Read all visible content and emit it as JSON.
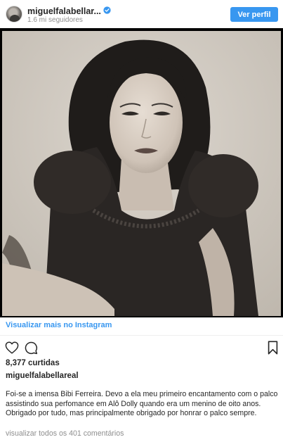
{
  "post": {
    "username": "miguelfalabellar...",
    "followers": "1.6 mi seguidores",
    "view_profile_label": "Ver perfil",
    "view_more_label": "Visualizar mais no Instagram",
    "likes": "8,377 curtidas",
    "caption_user": "miguelfalabellareal",
    "caption_text": "Foi-se a imensa Bibi Ferreira. Devo a ela meu primeiro encantamento com o palco assistindo sua perfomance em Alô Dolly quando era um menino de oito anos. Obrigado por tudo, mas principalmente obrigado por honrar o palco sempre.",
    "comments_link": "visualizar todos os 401 comentários"
  },
  "icons": {
    "verified": "verified-badge-icon",
    "like": "heart-icon",
    "comment": "comment-icon",
    "save": "bookmark-icon"
  },
  "colors": {
    "accent": "#3897f0",
    "text": "#262626",
    "muted": "#8e8e8e",
    "photo_frame": "#000000"
  }
}
